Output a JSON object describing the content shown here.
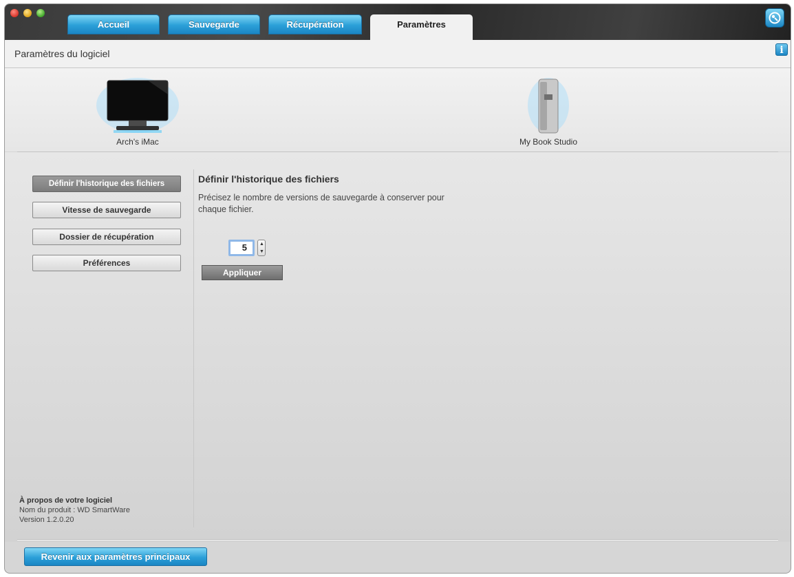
{
  "tabs": [
    {
      "label": "Accueil"
    },
    {
      "label": "Sauvegarde"
    },
    {
      "label": "Récupération"
    },
    {
      "label": "Paramètres"
    }
  ],
  "active_tab": "Paramètres",
  "header": {
    "title": "Paramètres du logiciel",
    "info_icon": "i"
  },
  "devices": {
    "computer": {
      "label": "Arch's iMac",
      "icon": "imac-icon"
    },
    "drive": {
      "label": "My Book Studio",
      "icon": "external-drive-icon"
    }
  },
  "sidebar": {
    "items": [
      {
        "label": "Définir l'historique des fichiers",
        "active": true
      },
      {
        "label": "Vitesse de sauvegarde",
        "active": false
      },
      {
        "label": "Dossier de récupération",
        "active": false
      },
      {
        "label": "Préférences",
        "active": false
      }
    ]
  },
  "panel": {
    "title": "Définir l'historique des fichiers",
    "description": "Précisez le nombre de versions de sauvegarde à conserver pour chaque fichier.",
    "versions_value": "5",
    "apply_label": "Appliquer"
  },
  "about": {
    "title": "À propos de votre logiciel",
    "product": "Nom du produit : WD SmartWare",
    "version": "Version 1.2.0.20"
  },
  "footer": {
    "back_label": "Revenir aux paramètres principaux"
  },
  "colors": {
    "accent": "#2b9fd8",
    "active_nav": "#8a8a8a"
  }
}
